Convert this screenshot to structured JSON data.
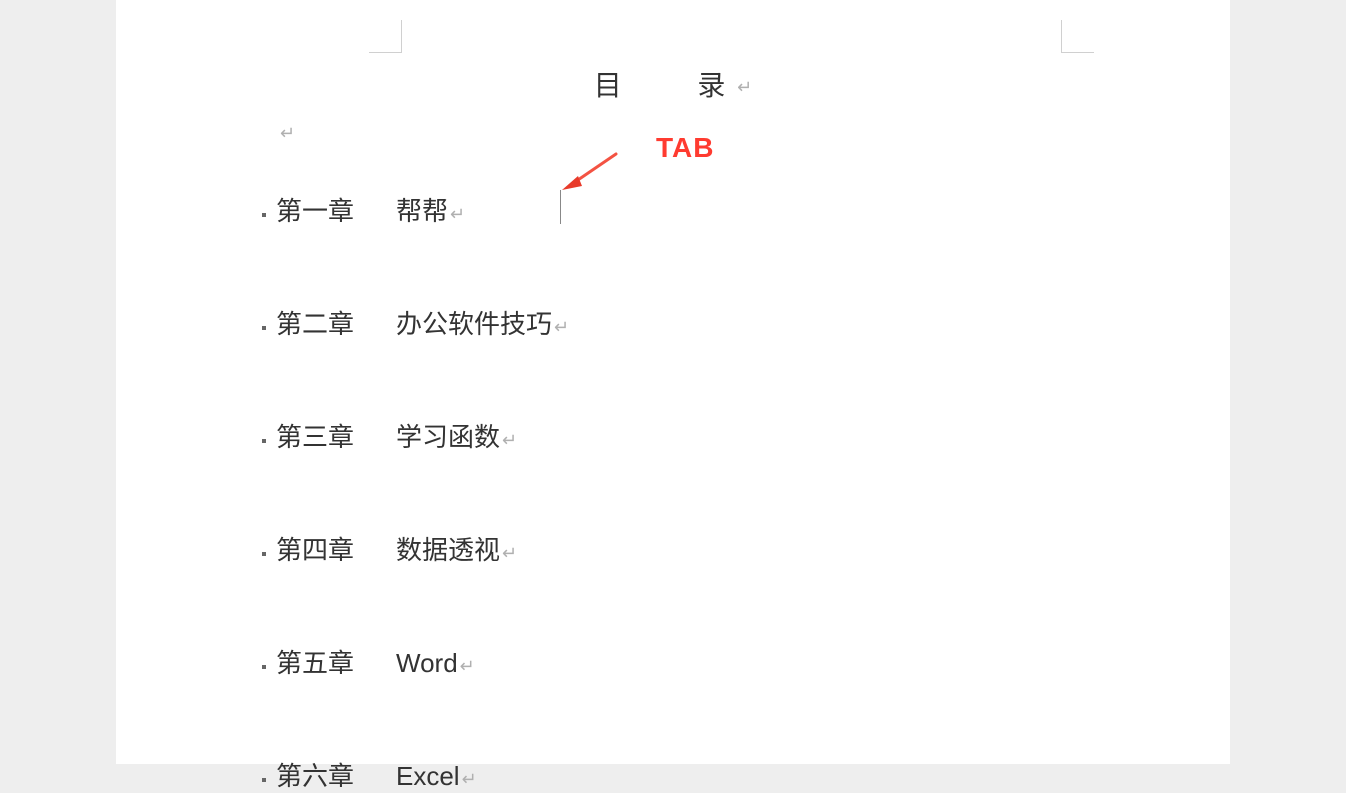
{
  "title": {
    "part1": "目",
    "part2": "录"
  },
  "annotation": "TAB",
  "paragraph_mark": "↵",
  "toc": [
    {
      "num": "第一章",
      "title": "帮帮"
    },
    {
      "num": "第二章",
      "title": "办公软件技巧"
    },
    {
      "num": "第三章",
      "title": "学习函数"
    },
    {
      "num": "第四章",
      "title": "数据透视"
    },
    {
      "num": "第五章",
      "title": "Word"
    },
    {
      "num": "第六章",
      "title": "Excel"
    }
  ]
}
